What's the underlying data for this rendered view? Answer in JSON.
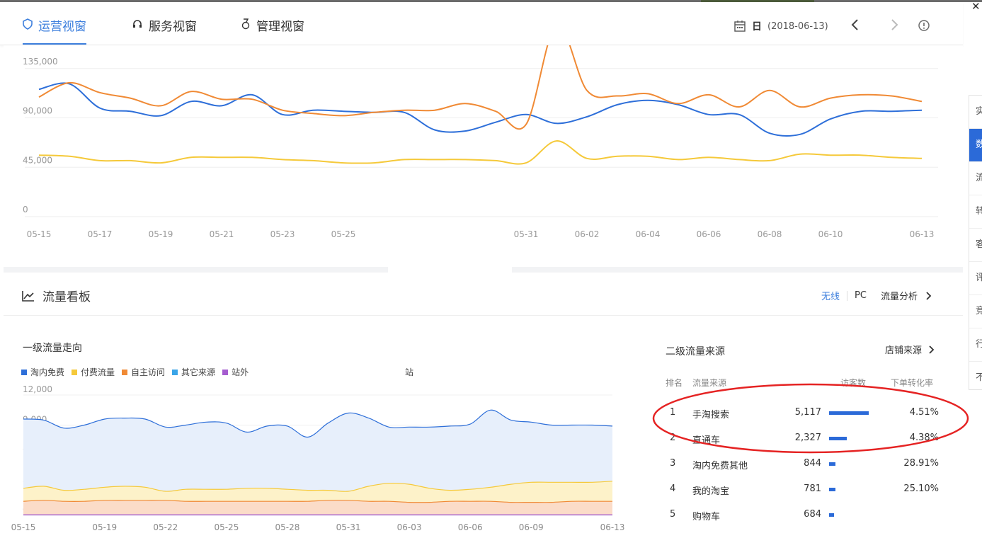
{
  "header": {
    "tabs": [
      {
        "label": "运营视窗",
        "active": true
      },
      {
        "label": "服务视窗",
        "active": false
      },
      {
        "label": "管理视窗",
        "active": false
      }
    ],
    "date_mode": "日",
    "date_value": "(2018-06-13)"
  },
  "colors": {
    "accent": "#3d7fdd",
    "line_blue": "#2e6fd9",
    "line_orange": "#f08a35",
    "line_yellow": "#f5c93a",
    "annotation_red": "#e52323"
  },
  "flow_board": {
    "title": "流量看板",
    "switch": [
      "无线",
      "PC"
    ],
    "analysis_link": "流量分析",
    "level1": {
      "title": "一级流量走向",
      "legend": [
        {
          "name": "淘内免费",
          "color": "#2e6fd9"
        },
        {
          "name": "付费流量",
          "color": "#f5c93a"
        },
        {
          "name": "自主访问",
          "color": "#f08a35"
        },
        {
          "name": "其它来源",
          "color": "#3aa5e8"
        },
        {
          "name": "站外",
          "color": "#a55ccf"
        }
      ],
      "legend_tail": "站"
    },
    "level2": {
      "title": "二级流量来源",
      "store_link": "店铺来源",
      "columns": [
        "排名",
        "流量来源",
        "访客数",
        "下单转化率"
      ],
      "rows": [
        {
          "rank": "1",
          "source": "手淘搜索",
          "visitors": "5,117",
          "visitors_num": 5117,
          "conversion": "4.51%"
        },
        {
          "rank": "2",
          "source": "直通车",
          "visitors": "2,327",
          "visitors_num": 2327,
          "conversion": "4.38%"
        },
        {
          "rank": "3",
          "source": "淘内免费其他",
          "visitors": "844",
          "visitors_num": 844,
          "conversion": "28.91%"
        },
        {
          "rank": "4",
          "source": "我的淘宝",
          "visitors": "781",
          "visitors_num": 781,
          "conversion": "25.10%"
        },
        {
          "rank": "5",
          "source": "购物车",
          "visitors": "684",
          "visitors_num": 684,
          "conversion": ""
        }
      ]
    }
  },
  "side_nav": [
    "实",
    "数",
    "流",
    "转",
    "客",
    "评",
    "竞",
    "行",
    "不"
  ],
  "chart_data": [
    {
      "type": "line",
      "x": [
        "05-15",
        "05-16",
        "05-17",
        "05-18",
        "05-19",
        "05-20",
        "05-21",
        "05-22",
        "05-23",
        "05-24",
        "05-25",
        "05-26",
        "05-27",
        "05-28",
        "05-29",
        "05-30",
        "05-31",
        "06-01",
        "06-02",
        "06-03",
        "06-04",
        "06-05",
        "06-06",
        "06-07",
        "06-08",
        "06-09",
        "06-10",
        "06-11",
        "06-12",
        "06-13"
      ],
      "x_tick_labels": [
        "05-15",
        "05-17",
        "05-19",
        "05-21",
        "05-23",
        "05-25",
        "05-31",
        "06-02",
        "06-04",
        "06-06",
        "06-08",
        "06-10",
        "06-13"
      ],
      "y_tick_labels": [
        "0",
        "45,000",
        "90,000",
        "135,000"
      ],
      "ylim": [
        0,
        160000
      ],
      "series": [
        {
          "color": "#2e6fd9",
          "values": [
            116000,
            121000,
            99000,
            96000,
            92000,
            105000,
            101000,
            111000,
            93000,
            97000,
            96000,
            95000,
            95000,
            79000,
            78000,
            86000,
            93000,
            85000,
            91000,
            102000,
            106000,
            102000,
            93000,
            93000,
            76000,
            75000,
            89000,
            96000,
            96000,
            97000
          ]
        },
        {
          "color": "#f08a35",
          "values": [
            109000,
            122000,
            113000,
            108000,
            101000,
            114000,
            107000,
            107000,
            97000,
            94000,
            92000,
            95000,
            97000,
            97000,
            103000,
            96000,
            84000,
            175000,
            115000,
            110000,
            112000,
            103000,
            111000,
            100000,
            115000,
            100000,
            108000,
            111000,
            110000,
            105000
          ]
        },
        {
          "color": "#f5c93a",
          "values": [
            56000,
            55000,
            51000,
            51000,
            49000,
            54000,
            54000,
            54000,
            52000,
            51000,
            49000,
            49000,
            52000,
            52000,
            52000,
            51000,
            49000,
            69000,
            53000,
            55000,
            55000,
            52000,
            54000,
            52000,
            51000,
            57000,
            56000,
            56000,
            54000,
            53000
          ]
        }
      ]
    },
    {
      "type": "area",
      "x": [
        "05-15",
        "05-16",
        "05-17",
        "05-18",
        "05-19",
        "05-20",
        "05-21",
        "05-22",
        "05-23",
        "05-24",
        "05-25",
        "05-26",
        "05-27",
        "05-28",
        "05-29",
        "05-30",
        "05-31",
        "06-01",
        "06-02",
        "06-03",
        "06-04",
        "06-05",
        "06-06",
        "06-07",
        "06-08",
        "06-09",
        "06-10",
        "06-11",
        "06-12",
        "06-13"
      ],
      "x_tick_labels": [
        "05-15",
        "05-19",
        "05-22",
        "05-25",
        "05-28",
        "05-31",
        "06-03",
        "06-06",
        "06-09",
        "06-13"
      ],
      "y_tick_labels": [
        "0",
        "3,000",
        "6,000",
        "9,000",
        "12,000"
      ],
      "ylim": [
        0,
        12000
      ],
      "series": [
        {
          "name": "淘内免费",
          "color": "#2e6fd9",
          "values": [
            9600,
            9500,
            8700,
            9000,
            9600,
            9700,
            9600,
            8800,
            9000,
            9300,
            9200,
            8300,
            8900,
            8900,
            7800,
            9200,
            10200,
            9700,
            8800,
            8800,
            8800,
            8900,
            9100,
            10500,
            9500,
            9300,
            9000,
            9000,
            9000,
            8900
          ]
        },
        {
          "name": "付费流量",
          "color": "#f5c93a",
          "values": [
            2700,
            2900,
            2500,
            2600,
            2800,
            2900,
            2800,
            2400,
            2600,
            2600,
            2600,
            2700,
            2700,
            2600,
            2500,
            2500,
            2400,
            2900,
            3200,
            3100,
            2700,
            2500,
            2600,
            2800,
            3100,
            3300,
            3300,
            3300,
            3300,
            3400
          ]
        },
        {
          "name": "自主访问",
          "color": "#f08a35",
          "values": [
            1400,
            1500,
            1400,
            1400,
            1500,
            1500,
            1500,
            1500,
            1400,
            1400,
            1400,
            1400,
            1400,
            1400,
            1400,
            1500,
            1500,
            1400,
            1400,
            1300,
            1300,
            1400,
            1400,
            1400,
            1300,
            1300,
            1300,
            1400,
            1400,
            1400
          ]
        },
        {
          "name": "站外",
          "color": "#a55ccf",
          "values": [
            60,
            60,
            60,
            60,
            60,
            60,
            60,
            60,
            60,
            60,
            60,
            60,
            60,
            60,
            60,
            60,
            60,
            60,
            60,
            60,
            60,
            60,
            60,
            60,
            60,
            60,
            60,
            60,
            60,
            60
          ]
        }
      ]
    }
  ]
}
